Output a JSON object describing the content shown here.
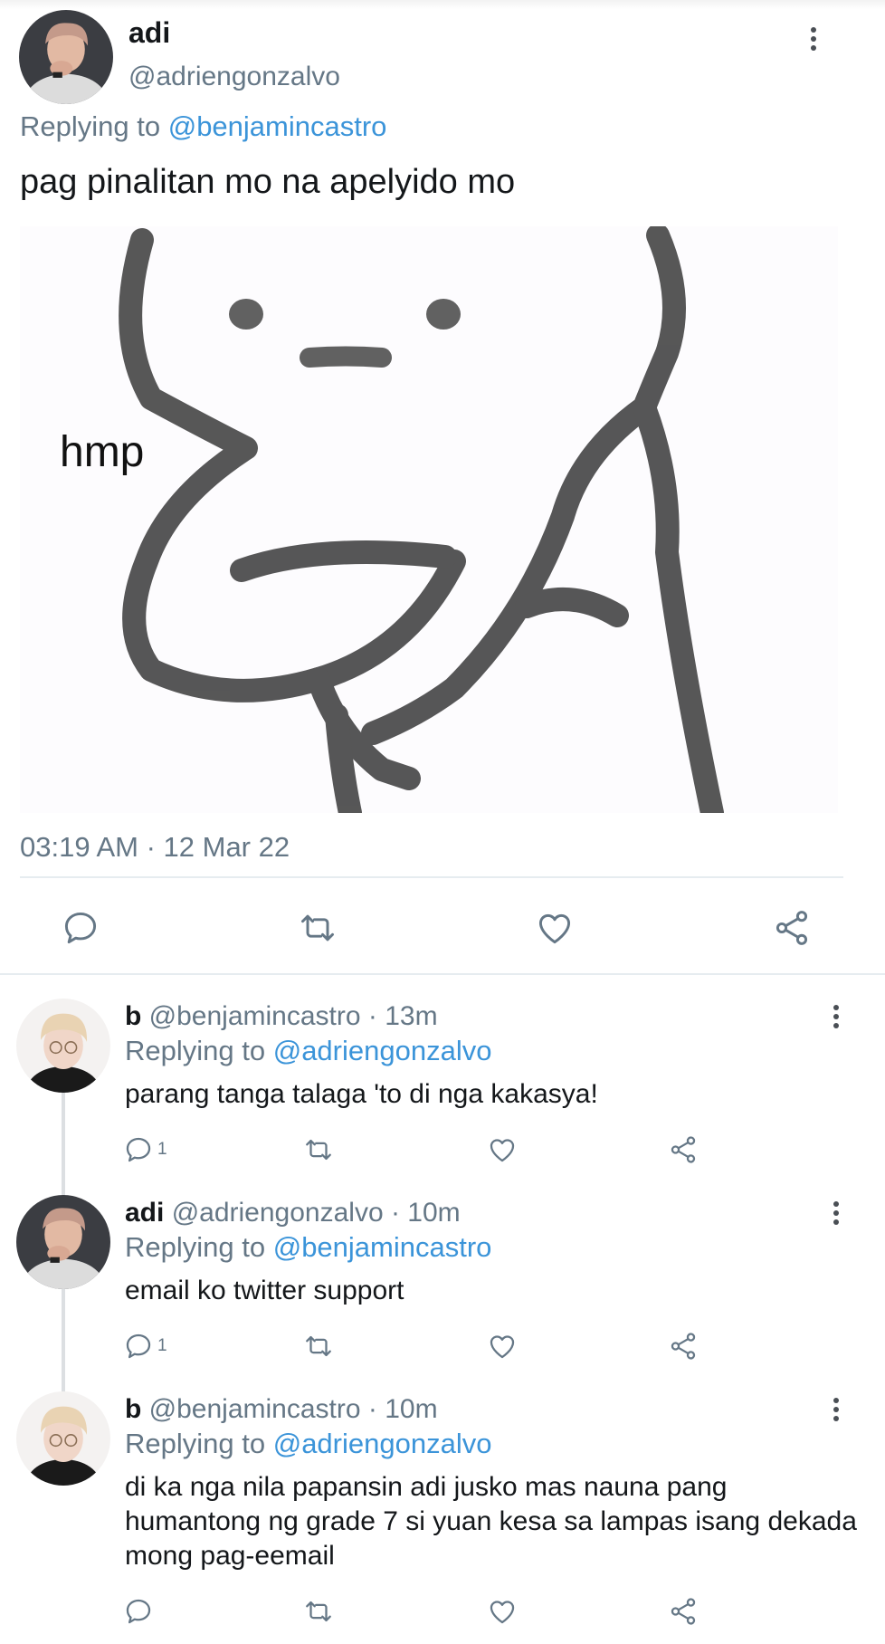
{
  "main_tweet": {
    "name": "adi",
    "handle": "@adriengonzalvo",
    "replying_prefix": "Replying to",
    "replying_to": "@benjamincastro",
    "text": "pag pinalitan mo na apelyido mo",
    "image_caption": "hmp",
    "timestamp": "03:19 AM · 12 Mar 22",
    "actions": [
      "reply-icon",
      "retweet-icon",
      "like-icon",
      "share-icon"
    ]
  },
  "replies": [
    {
      "name": "b",
      "handle": "@benjamincastro",
      "time": "· 13m",
      "replying_prefix": "Replying to",
      "replying_to": "@adriengonzalvo",
      "text": "parang tanga talaga 'to di nga kakasya!",
      "reply_count": "1"
    },
    {
      "name": "adi",
      "handle": "@adriengonzalvo",
      "time": "· 10m",
      "replying_prefix": "Replying to",
      "replying_to": "@benjamincastro",
      "text": "email ko twitter support",
      "reply_count": "1"
    },
    {
      "name": "b",
      "handle": "@benjamincastro",
      "time": "· 10m",
      "replying_prefix": "Replying to",
      "replying_to": "@adriengonzalvo",
      "text": "di ka nga nila papansin adi jusko mas nauna pang humantong ng grade 7 si yuan kesa sa lampas isang dekada mong pag-eemail",
      "reply_count": ""
    }
  ],
  "colors": {
    "link": "#3b94d9",
    "secondary_text": "#657786",
    "primary_text": "#14171a",
    "divider": "#e6ecf0"
  }
}
